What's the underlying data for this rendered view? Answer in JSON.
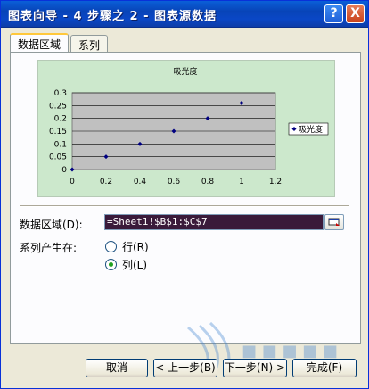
{
  "window": {
    "title": "图表向导 - 4 步骤之 2 - 图表源数据",
    "help_label": "?",
    "close_label": "X"
  },
  "tabs": [
    {
      "label": "数据区域",
      "active": true
    },
    {
      "label": "系列",
      "active": false
    }
  ],
  "chart_data": {
    "type": "scatter",
    "title": "吸光度",
    "xlabel": "",
    "ylabel": "",
    "x_ticks": [
      "0",
      "0.2",
      "0.4",
      "0.6",
      "0.8",
      "1",
      "1.2"
    ],
    "y_ticks": [
      "0",
      "0.05",
      "0.1",
      "0.15",
      "0.2",
      "0.25",
      "0.3"
    ],
    "xlim": [
      0,
      1.2
    ],
    "ylim": [
      0,
      0.3
    ],
    "grid": "horizontal",
    "legend_position": "right",
    "series": [
      {
        "name": "吸光度",
        "x": [
          0,
          0.2,
          0.4,
          0.6,
          0.8,
          1.0
        ],
        "y": [
          0,
          0.05,
          0.1,
          0.15,
          0.2,
          0.26
        ]
      }
    ],
    "colors": {
      "plot_area": "#c0c0c0",
      "marker": "#000080",
      "chart_area": "#cce8cc"
    }
  },
  "data_range": {
    "label": "数据区域(D):",
    "value": "=Sheet1!$B$1:$C$7"
  },
  "series_in": {
    "label": "系列产生在:",
    "options": [
      {
        "label": "行(R)",
        "checked": false
      },
      {
        "label": "列(L)",
        "checked": true
      }
    ]
  },
  "buttons": {
    "cancel": "取消",
    "back": "< 上一步(B)",
    "next": "下一步(N) >",
    "finish": "完成(F)"
  }
}
